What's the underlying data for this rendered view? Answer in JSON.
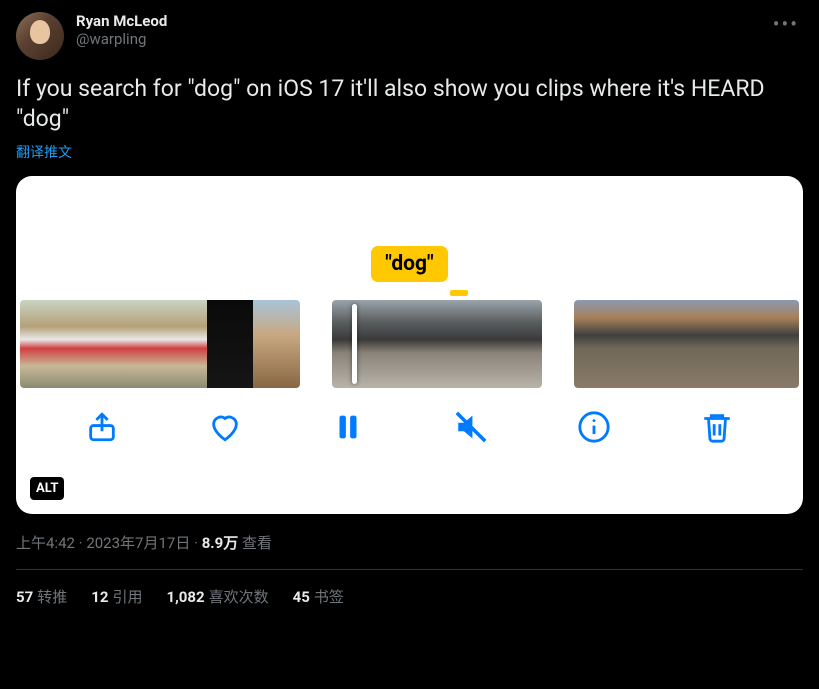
{
  "user": {
    "display_name": "Ryan McLeod",
    "handle": "@warpling"
  },
  "tweet": {
    "text": "If you search for \"dog\" on iOS 17 it'll also show you clips where it's HEARD \"dog\"",
    "translate_label": "翻译推文"
  },
  "media": {
    "search_tag": "\"dog\"",
    "alt_badge": "ALT"
  },
  "meta": {
    "time": "上午4:42",
    "date": "2023年7月17日",
    "sep": " · ",
    "views_number": "8.9万",
    "views_label": " 查看"
  },
  "stats": {
    "retweets_count": "57",
    "retweets_label": "转推",
    "quotes_count": "12",
    "quotes_label": "引用",
    "likes_count": "1,082",
    "likes_label": "喜欢次数",
    "bookmarks_count": "45",
    "bookmarks_label": "书签"
  }
}
